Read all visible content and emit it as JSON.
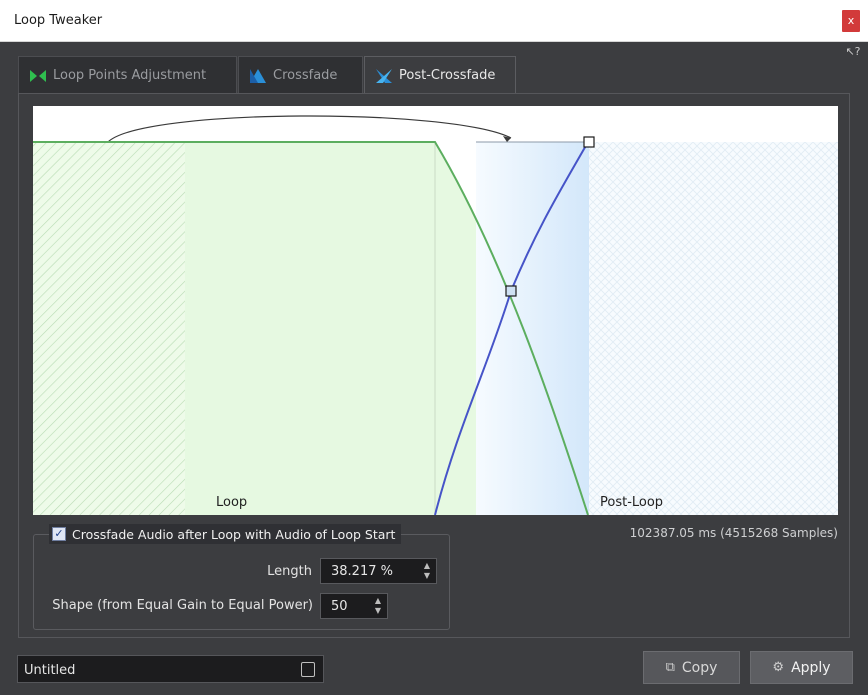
{
  "window": {
    "title": "Loop Tweaker",
    "close_glyph": "x"
  },
  "tabs": [
    {
      "label": "Loop Points Adjustment",
      "icon": "loop-points-icon",
      "active": false
    },
    {
      "label": "Crossfade",
      "icon": "crossfade-icon",
      "active": false
    },
    {
      "label": "Post-Crossfade",
      "icon": "post-crossfade-icon",
      "active": true
    }
  ],
  "graph": {
    "loop_label": "Loop",
    "post_loop_label": "Post-Loop"
  },
  "info_text": "102387.05 ms (4515268 Samples)",
  "crossfade": {
    "checkbox_label": "Crossfade Audio after Loop with Audio of Loop Start",
    "checked": true,
    "length_label": "Length",
    "length_value": "38.217 %",
    "shape_label": "Shape (from Equal Gain to Equal Power)",
    "shape_value": "50"
  },
  "footer": {
    "preset_value": "Untitled",
    "copy_label": "Copy",
    "apply_label": "Apply"
  },
  "colors": {
    "loop_green": "#5cae5f",
    "crossfade_blue": "#4654c8",
    "loop_fill": "#e6f9e1",
    "crossfade_fill": "#d7e9fa"
  }
}
